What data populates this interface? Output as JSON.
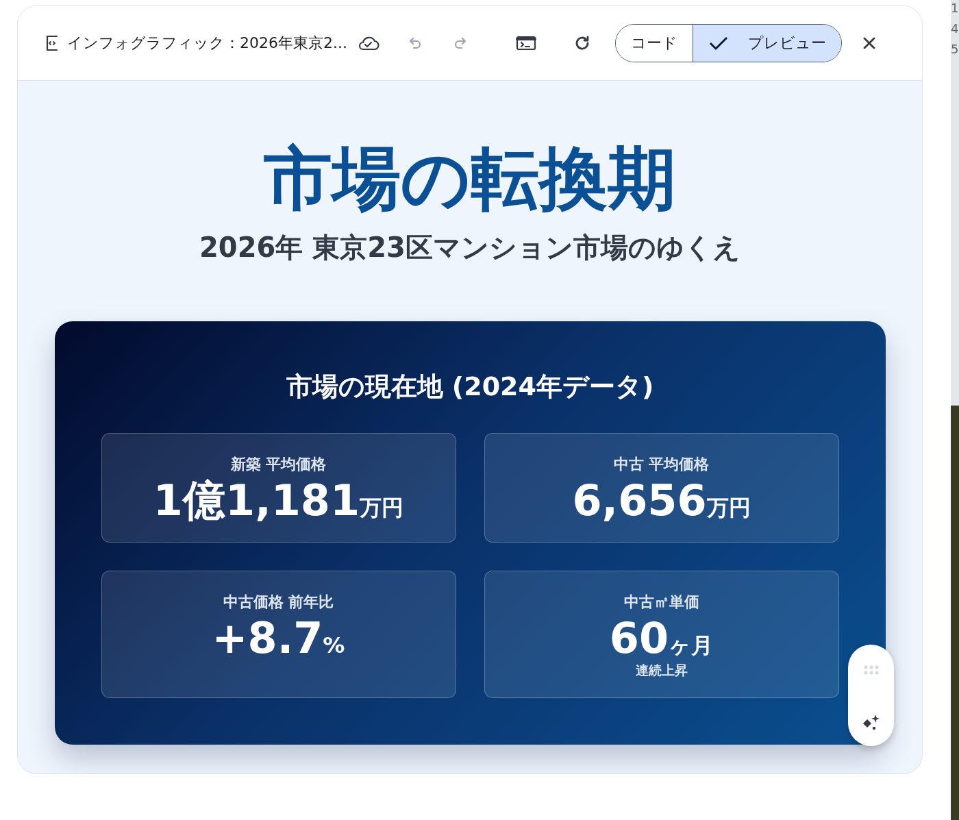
{
  "toolbar": {
    "title": "インフォグラフィック：2026年東京2...",
    "modes": [
      {
        "label": "コード",
        "selected": false
      },
      {
        "label": "プレビュー",
        "selected": true
      }
    ]
  },
  "preview": {
    "headline": "市場の転換期",
    "subheadline": "2026年 東京23区マンション市場のゆくえ",
    "panel": {
      "title": "市場の現在地 (2024年データ)",
      "stats": [
        {
          "label": "新築 平均価格",
          "value": "1億1,181",
          "unit": "万円"
        },
        {
          "label": "中古 平均価格",
          "value": "6,656",
          "unit": "万円"
        },
        {
          "label": "中古価格 前年比",
          "value": "+8.7",
          "unit": "%"
        },
        {
          "label": "中古㎡単価",
          "value": "60",
          "unit": "ヶ月",
          "note": "連続上昇"
        }
      ]
    }
  },
  "background_window": {
    "line_numbers": [
      "1",
      "4",
      "5"
    ]
  }
}
